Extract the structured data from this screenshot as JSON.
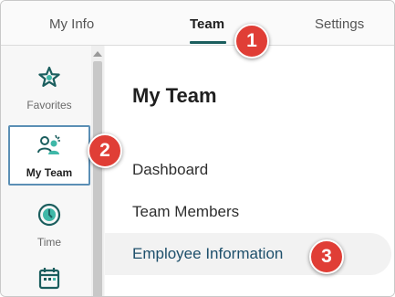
{
  "tabs": [
    {
      "label": "My Info",
      "active": false
    },
    {
      "label": "Team",
      "active": true
    },
    {
      "label": "Settings",
      "active": false
    }
  ],
  "sidebar": {
    "items": [
      {
        "label": "Favorites",
        "icon": "star-icon",
        "active": false
      },
      {
        "label": "My Team",
        "icon": "team-icon",
        "active": true
      },
      {
        "label": "Time",
        "icon": "clock-icon",
        "active": false
      },
      {
        "label": "",
        "icon": "calendar-icon",
        "active": false
      }
    ]
  },
  "main": {
    "title": "My Team",
    "links": [
      {
        "label": "Dashboard"
      },
      {
        "label": "Team Members"
      },
      {
        "label": "Employee Information",
        "highlighted": true
      }
    ]
  },
  "callouts": [
    "1",
    "2",
    "3"
  ],
  "colors": {
    "accent_teal": "#1b5e5e",
    "callout_red": "#e03e36",
    "active_border": "#5b8fb5",
    "link_highlight": "#1d4f6b"
  }
}
